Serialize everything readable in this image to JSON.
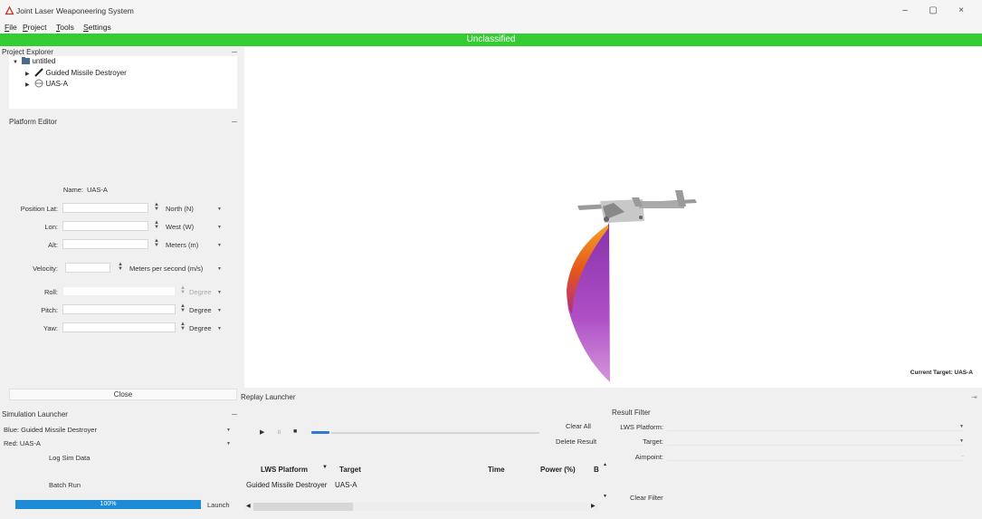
{
  "window": {
    "title": "Joint Laser Weaponeering System",
    "controls": {
      "minimize": "–",
      "maximize": "▢",
      "close": "×"
    }
  },
  "menu": [
    "File",
    "Project",
    "Tools",
    "Settings"
  ],
  "banner": {
    "text": "Unclassified",
    "color": "#33cc33"
  },
  "project_explorer": {
    "title": "Project Explorer",
    "root": "untitled",
    "items": [
      {
        "label": "Guided Missile Destroyer",
        "icon": "destroyer-icon"
      },
      {
        "label": "UAS-A",
        "icon": "uas-icon"
      }
    ]
  },
  "platform_editor": {
    "title": "Platform Editor",
    "name_label": "Name:",
    "name_value": "UAS-A",
    "position_lat_label": "Position Lat:",
    "lat_unit": "North (N)",
    "lon_label": "Lon:",
    "lon_unit": "West (W)",
    "alt_label": "Alt:",
    "alt_unit": "Meters (m)",
    "velocity_label": "Velocity:",
    "velocity_unit": "Meters per second (m/s)",
    "roll_label": "Roll:",
    "roll_unit": "Degree",
    "pitch_label": "Pitch:",
    "pitch_unit": "Degree",
    "yaw_label": "Yaw:",
    "yaw_unit": "Degree"
  },
  "close_button": "Close",
  "viewport": {
    "current_target": "Current Target: UAS-A"
  },
  "simulation_launcher": {
    "title": "Simulation Launcher",
    "blue": "Blue:  Guided Missile Destroyer",
    "red": "Red:  UAS-A",
    "log_sim_data": "Log Sim Data",
    "batch_run": "Batch Run",
    "progress_text": "100%",
    "progress_fraction": 1.0,
    "launch": "Launch"
  },
  "replay_launcher": {
    "title": "Replay Launcher",
    "clear_all": "Clear All",
    "delete_result": "Delete Result",
    "table_headers": [
      "LWS Platform",
      "Target",
      "Time",
      "Power (%)",
      "B"
    ],
    "rows": [
      {
        "platform": "Guided Missile Destroyer",
        "target": "UAS-A"
      }
    ]
  },
  "result_filter": {
    "title": "Result Filter",
    "lws_platform_label": "LWS Platform:",
    "target_label": "Target:",
    "aimpoint_label": "Aimpoint:",
    "clear_filter": "Clear Filter"
  }
}
